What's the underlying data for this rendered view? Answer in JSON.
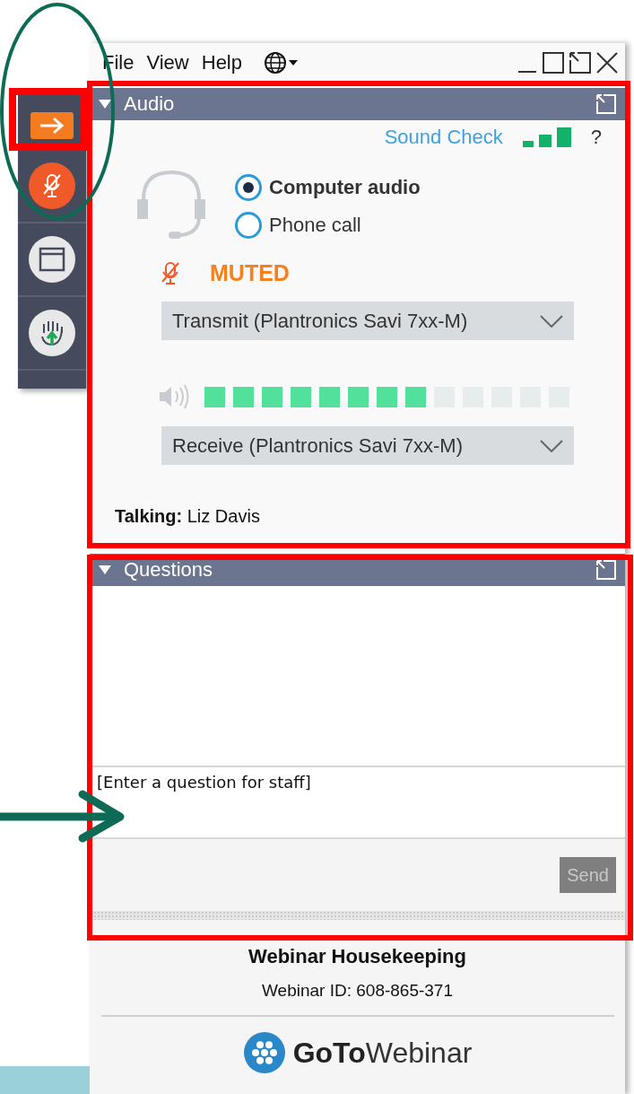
{
  "menu": [
    "File",
    "View",
    "Help"
  ],
  "sidebar": [
    {
      "kind": "collapse"
    },
    {
      "kind": "mic"
    },
    {
      "kind": "screen"
    },
    {
      "kind": "hand"
    }
  ],
  "audio": {
    "title": "Audio",
    "expanded": true,
    "sound_check": "Sound Check",
    "help": "?",
    "options": [
      {
        "label": "Computer audio",
        "selected": true
      },
      {
        "label": "Phone call",
        "selected": false
      }
    ],
    "muted": true,
    "mute_label": "MUTED",
    "transmit": "Transmit (Plantronics Savi 7xx-M)",
    "speaker": {
      "level": 0.615
    },
    "receive": "Receive (Plantronics Savi 7xx-M)",
    "talking_label": "Talking:",
    "talking_name": "Liz Davis"
  },
  "questions": {
    "title": "Questions",
    "expanded": true,
    "placeholder": "[Enter a question for staff]",
    "send": "Send",
    "send_disabled": true
  },
  "footer": {
    "title": "Webinar Housekeeping",
    "webinar_id": "Webinar ID: 608-865-371",
    "logo_bold": "GoTo",
    "logo_light": "Webinar"
  }
}
